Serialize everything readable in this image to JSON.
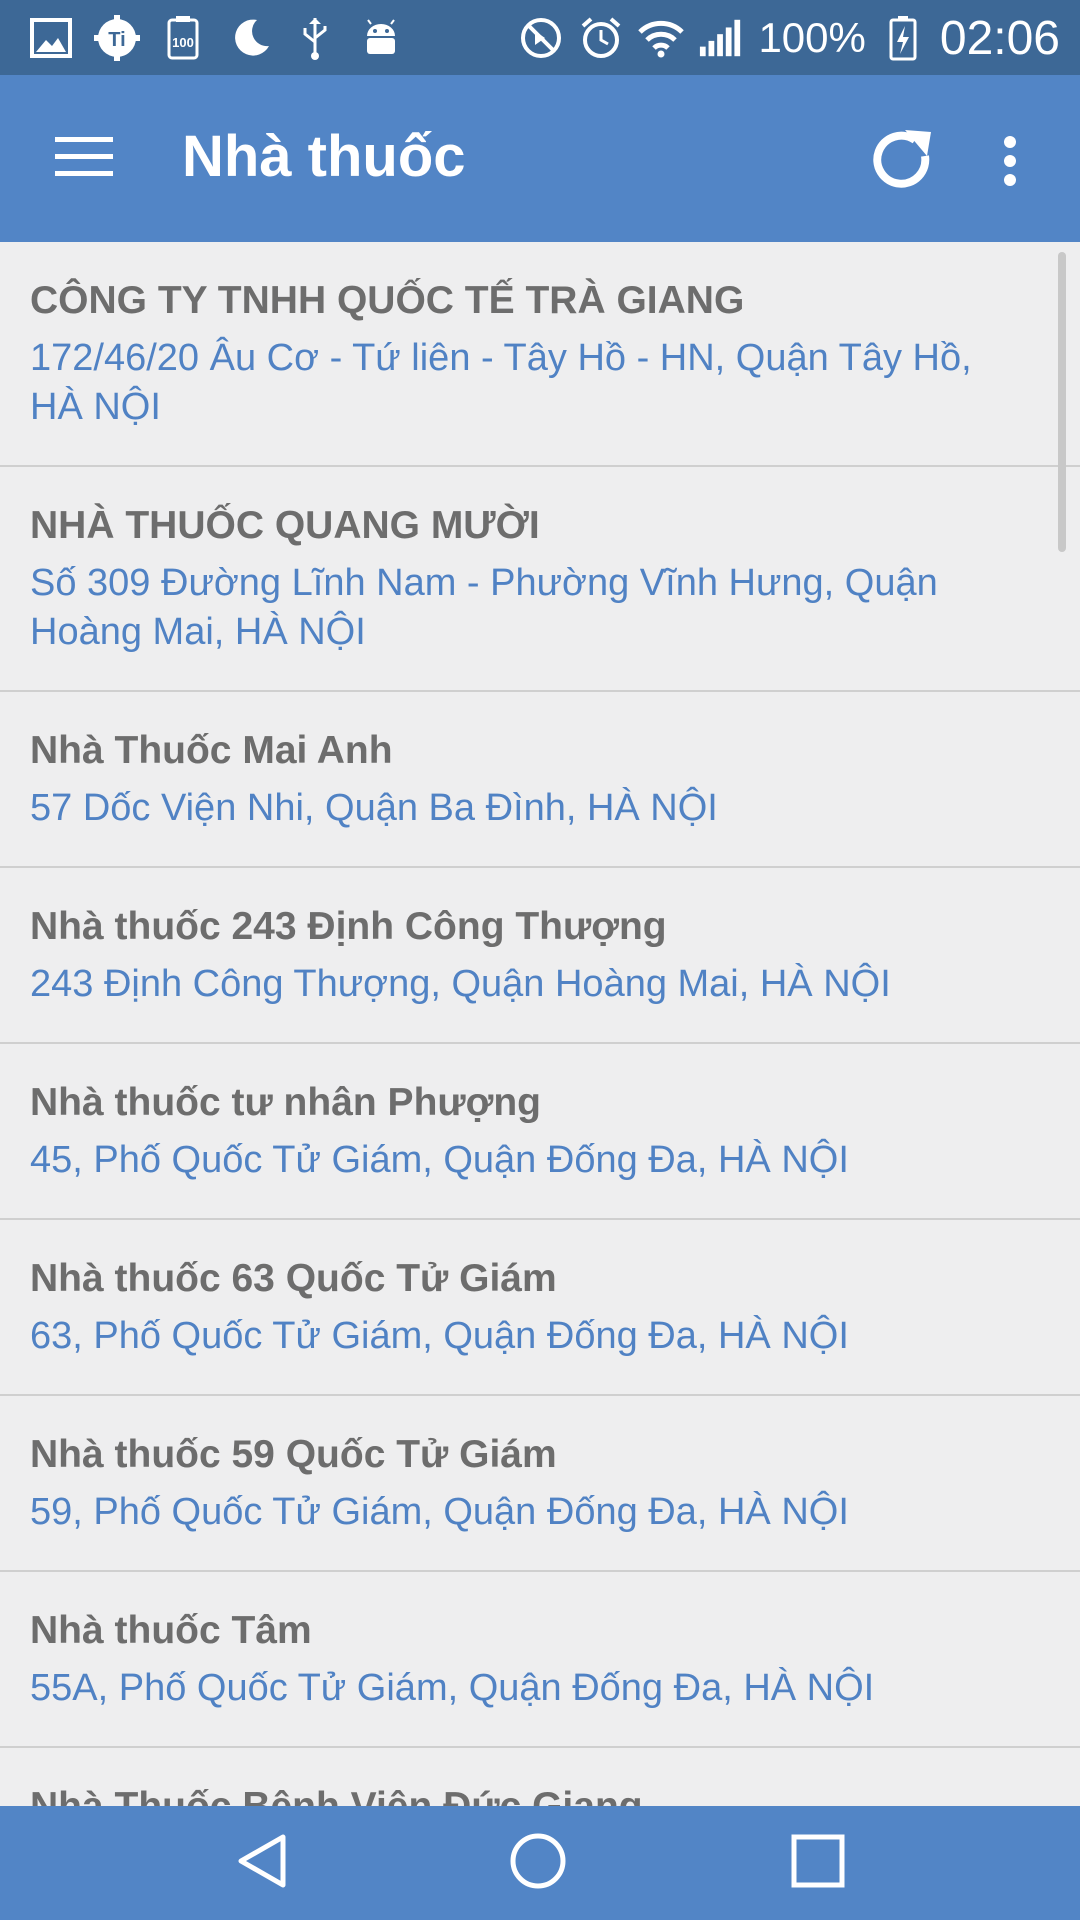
{
  "status_bar": {
    "battery": "100%",
    "time": "02:06",
    "left_icons": [
      "image-icon",
      "ti-app-icon",
      "storage-100-icon",
      "moon-icon",
      "usb-icon",
      "android-icon"
    ],
    "right_icons": [
      "no-sound-icon",
      "alarm-icon",
      "wifi-icon",
      "signal-icon",
      "battery-charging-icon"
    ]
  },
  "app_bar": {
    "title": "Nhà thuốc"
  },
  "pharmacies": [
    {
      "name": "CÔNG TY TNHH QUỐC TẾ TRÀ GIANG",
      "address": " 172/46/20 Âu Cơ - Tứ liên - Tây Hồ - HN, Quận Tây Hồ, HÀ NỘI"
    },
    {
      "name": "NHÀ THUỐC QUANG MƯỜI",
      "address": " Số 309 Đường Lĩnh Nam - Phường Vĩnh Hưng, Quận Hoàng Mai, HÀ NỘI"
    },
    {
      "name": "Nhà Thuốc Mai Anh",
      "address": " 57 Dốc Viện Nhi, Quận Ba Đình, HÀ NỘI"
    },
    {
      "name": "Nhà thuốc 243 Định Công Thượng",
      "address": " 243 Định Công Thượng, Quận Hoàng Mai, HÀ NỘI"
    },
    {
      "name": "Nhà thuốc tư nhân Phượng",
      "address": " 45, Phố Quốc Tử Giám, Quận Đống Đa, HÀ NỘI"
    },
    {
      "name": "Nhà thuốc 63 Quốc Tử Giám",
      "address": " 63, Phố Quốc Tử Giám, Quận Đống Đa, HÀ NỘI"
    },
    {
      "name": "Nhà thuốc 59 Quốc Tử Giám",
      "address": " 59, Phố Quốc Tử Giám, Quận Đống Đa, HÀ NỘI"
    },
    {
      "name": "Nhà thuốc Tâm",
      "address": " 55A, Phố Quốc Tử Giám, Quận Đống Đa, HÀ NỘI"
    },
    {
      "name": "Nhà Thuốc Bệnh Viện Đức Giang",
      "address": ""
    }
  ],
  "nav_bar": {
    "icons": [
      "back-icon",
      "home-icon",
      "recents-icon"
    ]
  },
  "colors": {
    "status_bar": "#3d6896",
    "app_bar": "#5285c6",
    "address_text": "#5082c4",
    "name_text": "#6d6d6d",
    "background": "#eeeeef"
  }
}
